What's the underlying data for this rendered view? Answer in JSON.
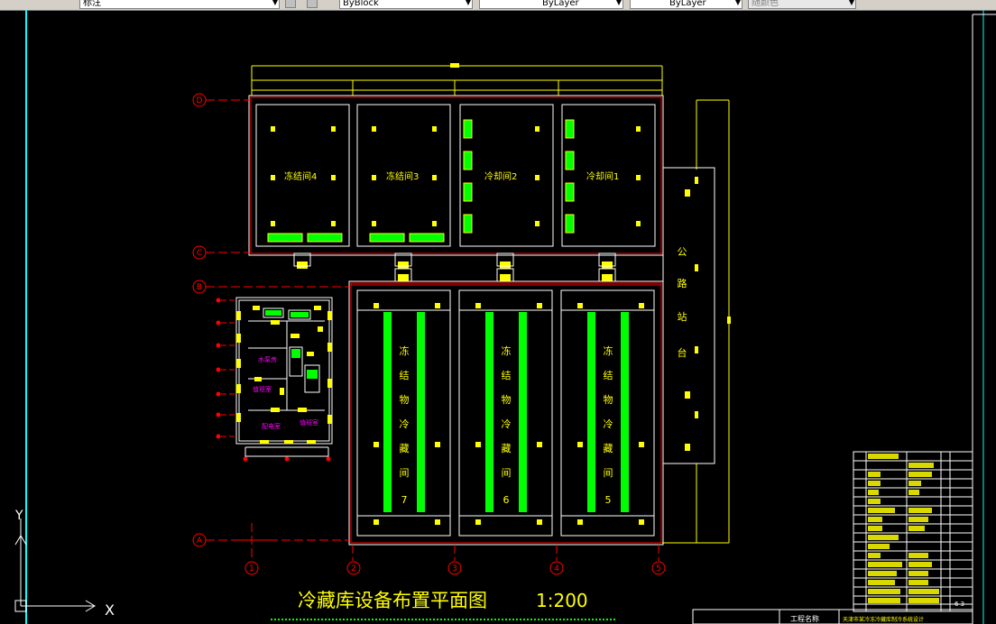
{
  "toolbar": {
    "style_value": "标注",
    "layer_value": "ByBlock",
    "linetype_value": "ByLayer",
    "lineweight_value": "ByLayer",
    "color_value": "随颜色"
  },
  "drawing": {
    "title": "冷藏库设备布置平面图",
    "scale": "1:200",
    "rooms_top": [
      "冻结间4",
      "冻结间3",
      "冷却间2",
      "冷却间1"
    ],
    "rooms_bottom": [
      {
        "chars": [
          "冻",
          "结",
          "物",
          "冷",
          "藏",
          "间"
        ],
        "number": "7"
      },
      {
        "chars": [
          "冻",
          "结",
          "物",
          "冷",
          "藏",
          "间"
        ],
        "number": "6"
      },
      {
        "chars": [
          "冻",
          "结",
          "物",
          "冷",
          "藏",
          "间"
        ],
        "number": "5"
      }
    ],
    "platform_chars": [
      "公",
      "路",
      "站",
      "台"
    ],
    "grid_axes_bottom": [
      "1",
      "2",
      "3",
      "4",
      "5"
    ],
    "grid_axes_left": [
      "D",
      "C",
      "B",
      "A"
    ],
    "annex_rooms": [
      "水泵房",
      "值班室",
      "配电室",
      "值班室"
    ],
    "ucs_labels": {
      "y": "Y",
      "x": "X"
    },
    "title_block": {
      "project_label": "工程名称",
      "project_name": "天津市某冷冻冷藏库制冷系统设计",
      "sheet": "6 3"
    }
  },
  "colors": {
    "background": "#000000",
    "frame": "#00ffff",
    "wall": "#ff0000",
    "room": "#ffffff",
    "equipment": "#ffff00",
    "evaporator": "#00ff00",
    "annex_text": "#ff00ff",
    "title_text": "#ffff00"
  }
}
